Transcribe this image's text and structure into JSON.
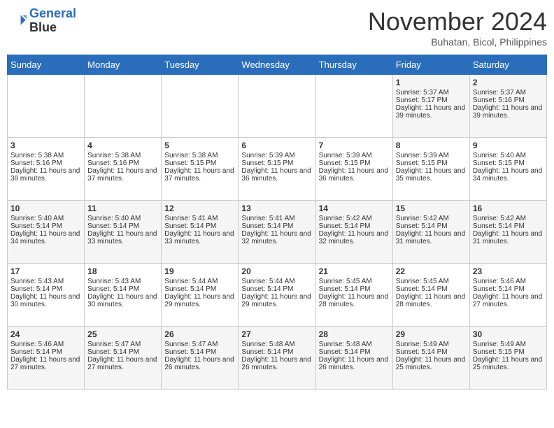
{
  "header": {
    "logo_line1": "General",
    "logo_line2": "Blue",
    "month_title": "November 2024",
    "location": "Buhatan, Bicol, Philippines"
  },
  "days_of_week": [
    "Sunday",
    "Monday",
    "Tuesday",
    "Wednesday",
    "Thursday",
    "Friday",
    "Saturday"
  ],
  "weeks": [
    [
      {
        "day": "",
        "content": ""
      },
      {
        "day": "",
        "content": ""
      },
      {
        "day": "",
        "content": ""
      },
      {
        "day": "",
        "content": ""
      },
      {
        "day": "",
        "content": ""
      },
      {
        "day": "1",
        "content": "Sunrise: 5:37 AM\nSunset: 5:17 PM\nDaylight: 11 hours and 39 minutes."
      },
      {
        "day": "2",
        "content": "Sunrise: 5:37 AM\nSunset: 5:16 PM\nDaylight: 11 hours and 39 minutes."
      }
    ],
    [
      {
        "day": "3",
        "content": "Sunrise: 5:38 AM\nSunset: 5:16 PM\nDaylight: 11 hours and 38 minutes."
      },
      {
        "day": "4",
        "content": "Sunrise: 5:38 AM\nSunset: 5:16 PM\nDaylight: 11 hours and 37 minutes."
      },
      {
        "day": "5",
        "content": "Sunrise: 5:38 AM\nSunset: 5:15 PM\nDaylight: 11 hours and 37 minutes."
      },
      {
        "day": "6",
        "content": "Sunrise: 5:39 AM\nSunset: 5:15 PM\nDaylight: 11 hours and 36 minutes."
      },
      {
        "day": "7",
        "content": "Sunrise: 5:39 AM\nSunset: 5:15 PM\nDaylight: 11 hours and 36 minutes."
      },
      {
        "day": "8",
        "content": "Sunrise: 5:39 AM\nSunset: 5:15 PM\nDaylight: 11 hours and 35 minutes."
      },
      {
        "day": "9",
        "content": "Sunrise: 5:40 AM\nSunset: 5:15 PM\nDaylight: 11 hours and 34 minutes."
      }
    ],
    [
      {
        "day": "10",
        "content": "Sunrise: 5:40 AM\nSunset: 5:14 PM\nDaylight: 11 hours and 34 minutes."
      },
      {
        "day": "11",
        "content": "Sunrise: 5:40 AM\nSunset: 5:14 PM\nDaylight: 11 hours and 33 minutes."
      },
      {
        "day": "12",
        "content": "Sunrise: 5:41 AM\nSunset: 5:14 PM\nDaylight: 11 hours and 33 minutes."
      },
      {
        "day": "13",
        "content": "Sunrise: 5:41 AM\nSunset: 5:14 PM\nDaylight: 11 hours and 32 minutes."
      },
      {
        "day": "14",
        "content": "Sunrise: 5:42 AM\nSunset: 5:14 PM\nDaylight: 11 hours and 32 minutes."
      },
      {
        "day": "15",
        "content": "Sunrise: 5:42 AM\nSunset: 5:14 PM\nDaylight: 11 hours and 31 minutes."
      },
      {
        "day": "16",
        "content": "Sunrise: 5:42 AM\nSunset: 5:14 PM\nDaylight: 11 hours and 31 minutes."
      }
    ],
    [
      {
        "day": "17",
        "content": "Sunrise: 5:43 AM\nSunset: 5:14 PM\nDaylight: 11 hours and 30 minutes."
      },
      {
        "day": "18",
        "content": "Sunrise: 5:43 AM\nSunset: 5:14 PM\nDaylight: 11 hours and 30 minutes."
      },
      {
        "day": "19",
        "content": "Sunrise: 5:44 AM\nSunset: 5:14 PM\nDaylight: 11 hours and 29 minutes."
      },
      {
        "day": "20",
        "content": "Sunrise: 5:44 AM\nSunset: 5:14 PM\nDaylight: 11 hours and 29 minutes."
      },
      {
        "day": "21",
        "content": "Sunrise: 5:45 AM\nSunset: 5:14 PM\nDaylight: 11 hours and 28 minutes."
      },
      {
        "day": "22",
        "content": "Sunrise: 5:45 AM\nSunset: 5:14 PM\nDaylight: 11 hours and 28 minutes."
      },
      {
        "day": "23",
        "content": "Sunrise: 5:46 AM\nSunset: 5:14 PM\nDaylight: 11 hours and 27 minutes."
      }
    ],
    [
      {
        "day": "24",
        "content": "Sunrise: 5:46 AM\nSunset: 5:14 PM\nDaylight: 11 hours and 27 minutes."
      },
      {
        "day": "25",
        "content": "Sunrise: 5:47 AM\nSunset: 5:14 PM\nDaylight: 11 hours and 27 minutes."
      },
      {
        "day": "26",
        "content": "Sunrise: 5:47 AM\nSunset: 5:14 PM\nDaylight: 11 hours and 26 minutes."
      },
      {
        "day": "27",
        "content": "Sunrise: 5:48 AM\nSunset: 5:14 PM\nDaylight: 11 hours and 26 minutes."
      },
      {
        "day": "28",
        "content": "Sunrise: 5:48 AM\nSunset: 5:14 PM\nDaylight: 11 hours and 26 minutes."
      },
      {
        "day": "29",
        "content": "Sunrise: 5:49 AM\nSunset: 5:14 PM\nDaylight: 11 hours and 25 minutes."
      },
      {
        "day": "30",
        "content": "Sunrise: 5:49 AM\nSunset: 5:15 PM\nDaylight: 11 hours and 25 minutes."
      }
    ]
  ]
}
